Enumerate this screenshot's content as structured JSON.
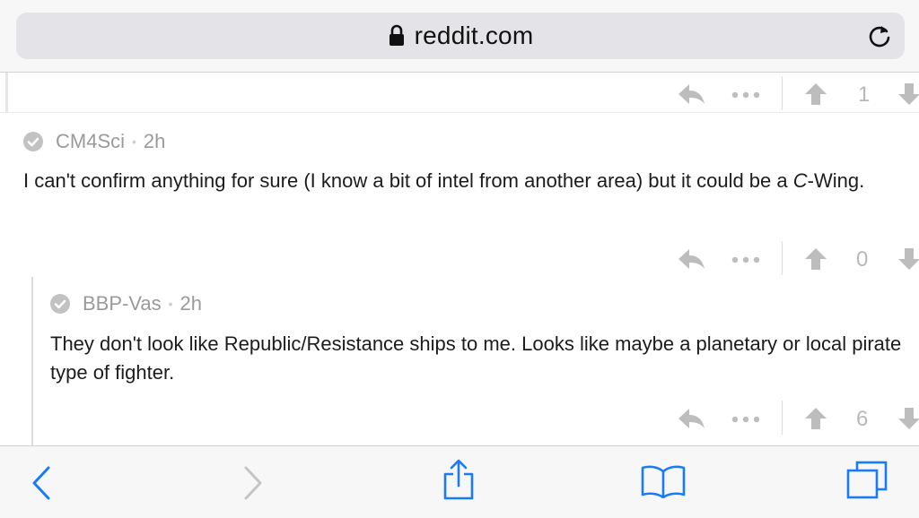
{
  "browser": {
    "url": "reddit.com",
    "icons": {
      "lock": "lock-icon",
      "reload": "reload-icon"
    }
  },
  "top_actions": {
    "vote_count": "1"
  },
  "comments": [
    {
      "author": "CM4Sci",
      "age": "2h",
      "text_before": "I can't confirm anything for sure (I know a bit of intel from another area) but it could be a ",
      "text_em": "C",
      "text_after": "-Wing.",
      "vote_count": "0"
    },
    {
      "author": "BBP-Vas",
      "age": "2h",
      "text": "They don't look like Republic/Resistance ships to me. Looks like maybe a planetary or local pirate type of fighter.",
      "vote_count": "6"
    }
  ],
  "toolbar": {
    "icons": [
      "back-icon",
      "forward-icon",
      "share-icon",
      "bookmarks-icon",
      "tabs-icon"
    ]
  },
  "colors": {
    "accent": "#1a7cf5",
    "disabled": "#c5c5c5",
    "muted": "#9a9a9a",
    "action_gray": "#bdbdbd"
  }
}
